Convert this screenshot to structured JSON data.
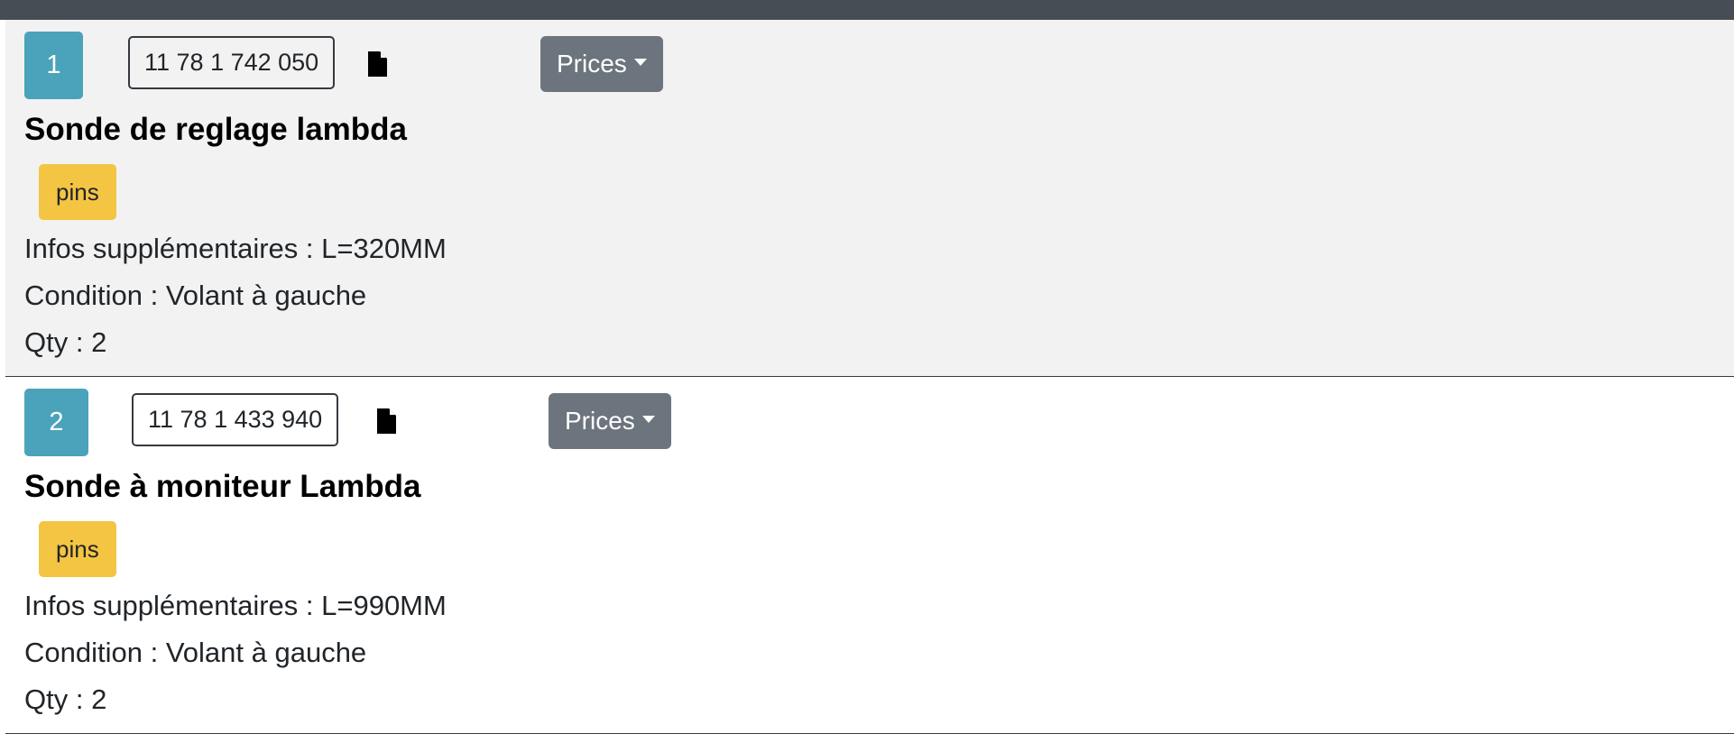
{
  "items": [
    {
      "index": "1",
      "part_number": "11 78 1 742 050",
      "prices_label": "Prices",
      "title": "Sonde de reglage lambda",
      "badge": "pins",
      "infos": "Infos supplémentaires : L=320MM",
      "condition": "Condition : Volant à gauche",
      "qty": "Qty : 2"
    },
    {
      "index": "2",
      "part_number": "11 78 1 433 940",
      "prices_label": "Prices",
      "title": "Sonde à moniteur Lambda",
      "badge": "pins",
      "infos": "Infos supplémentaires : L=990MM",
      "condition": "Condition : Volant à gauche",
      "qty": "Qty : 2"
    }
  ],
  "icons": {
    "document": "document-icon",
    "caret": "caret-down-icon"
  },
  "colors": {
    "topbar": "#474d55",
    "index_badge": "#4aa3ba",
    "prices_button": "#6c757d",
    "tag_badge": "#f4c542",
    "alt_row_background": "#f2f2f2"
  }
}
